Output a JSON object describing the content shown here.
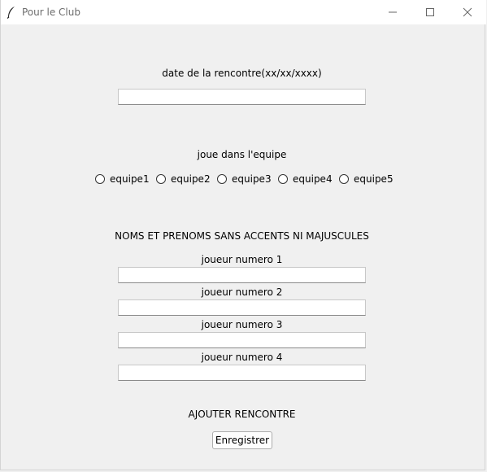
{
  "window": {
    "title": "Pour le Club"
  },
  "form": {
    "date_label": "date de la rencontre(xx/xx/xxxx)",
    "date_value": "",
    "team_label": "joue dans l'equipe",
    "teams": [
      "equipe1",
      "equipe2",
      "equipe3",
      "equipe4",
      "equipe5"
    ],
    "names_instruction": "NOMS ET PRENOMS SANS ACCENTS NI MAJUSCULES",
    "players": [
      {
        "label": "joueur numero 1",
        "value": ""
      },
      {
        "label": "joueur numero 2",
        "value": ""
      },
      {
        "label": "joueur numero 3",
        "value": ""
      },
      {
        "label": "joueur numero 4",
        "value": ""
      }
    ],
    "add_match_label": "AJOUTER RENCONTRE",
    "save_button_label": "Enregistrer"
  },
  "icons": {
    "app": "feather-icon",
    "minimize": "minimize-icon",
    "maximize": "maximize-icon",
    "close": "close-icon"
  }
}
